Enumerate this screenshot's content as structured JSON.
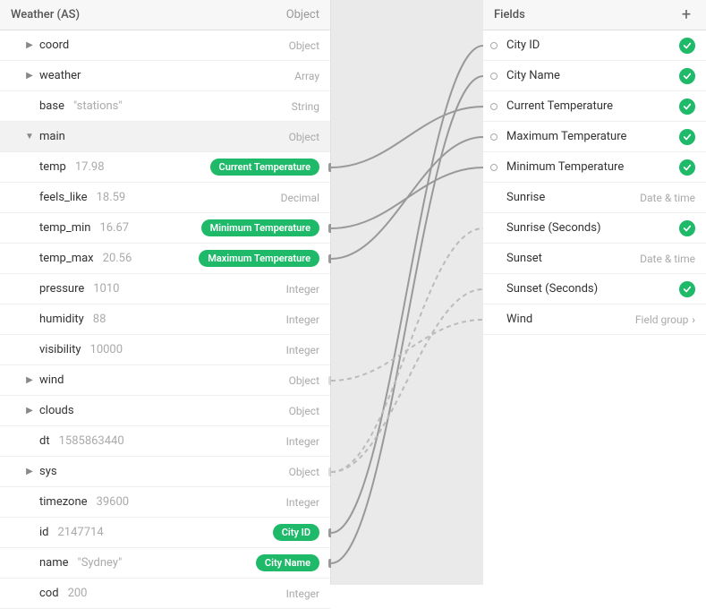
{
  "source": {
    "title": "Weather (AS)",
    "type": "Object",
    "rows": [
      {
        "key": "coord",
        "value": "",
        "type": "Object",
        "indent": 1,
        "caret": "right"
      },
      {
        "key": "weather",
        "value": "",
        "type": "Array",
        "indent": 1,
        "caret": "right"
      },
      {
        "key": "base",
        "value": "\"stations\"",
        "type": "String",
        "indent": 1
      },
      {
        "key": "main",
        "value": "",
        "type": "Object",
        "indent": 1,
        "caret": "down",
        "expanded": true
      },
      {
        "key": "temp",
        "value": "17.98",
        "badge": "Current Temperature",
        "indent": 2,
        "stub": true
      },
      {
        "key": "feels_like",
        "value": "18.59",
        "type": "Decimal",
        "indent": 2
      },
      {
        "key": "temp_min",
        "value": "16.67",
        "badge": "Minimum Temperature",
        "indent": 2,
        "stub": true
      },
      {
        "key": "temp_max",
        "value": "20.56",
        "badge": "Maximum Temperature",
        "indent": 2,
        "stub": true
      },
      {
        "key": "pressure",
        "value": "1010",
        "type": "Integer",
        "indent": 2
      },
      {
        "key": "humidity",
        "value": "88",
        "type": "Integer",
        "indent": 2
      },
      {
        "key": "visibility",
        "value": "10000",
        "type": "Integer",
        "indent": 1
      },
      {
        "key": "wind",
        "value": "",
        "type": "Object",
        "indent": 1,
        "caret": "right",
        "dashed_stub": true
      },
      {
        "key": "clouds",
        "value": "",
        "type": "Object",
        "indent": 1,
        "caret": "right"
      },
      {
        "key": "dt",
        "value": "1585863440",
        "type": "Integer",
        "indent": 1
      },
      {
        "key": "sys",
        "value": "",
        "type": "Object",
        "indent": 1,
        "caret": "right",
        "dashed_stub": true
      },
      {
        "key": "timezone",
        "value": "39600",
        "type": "Integer",
        "indent": 1
      },
      {
        "key": "id",
        "value": "2147714",
        "badge": "City ID",
        "indent": 1,
        "stub": true
      },
      {
        "key": "name",
        "value": "\"Sydney\"",
        "badge": "City Name",
        "indent": 1,
        "stub": true
      },
      {
        "key": "cod",
        "value": "200",
        "type": "Integer",
        "indent": 1
      }
    ]
  },
  "fields": {
    "title": "Fields",
    "items": [
      {
        "name": "City ID",
        "status": "check",
        "dot": true
      },
      {
        "name": "City Name",
        "status": "check",
        "dot": true
      },
      {
        "name": "Current Temperature",
        "status": "check",
        "dot": true
      },
      {
        "name": "Maximum Temperature",
        "status": "check",
        "dot": true
      },
      {
        "name": "Minimum Temperature",
        "status": "check",
        "dot": true
      },
      {
        "name": "Sunrise",
        "typeText": "Date & time"
      },
      {
        "name": "Sunrise (Seconds)",
        "status": "check"
      },
      {
        "name": "Sunset",
        "typeText": "Date & time"
      },
      {
        "name": "Sunset (Seconds)",
        "status": "check"
      },
      {
        "name": "Wind",
        "typeText": "Field group",
        "chevron": true
      }
    ]
  }
}
